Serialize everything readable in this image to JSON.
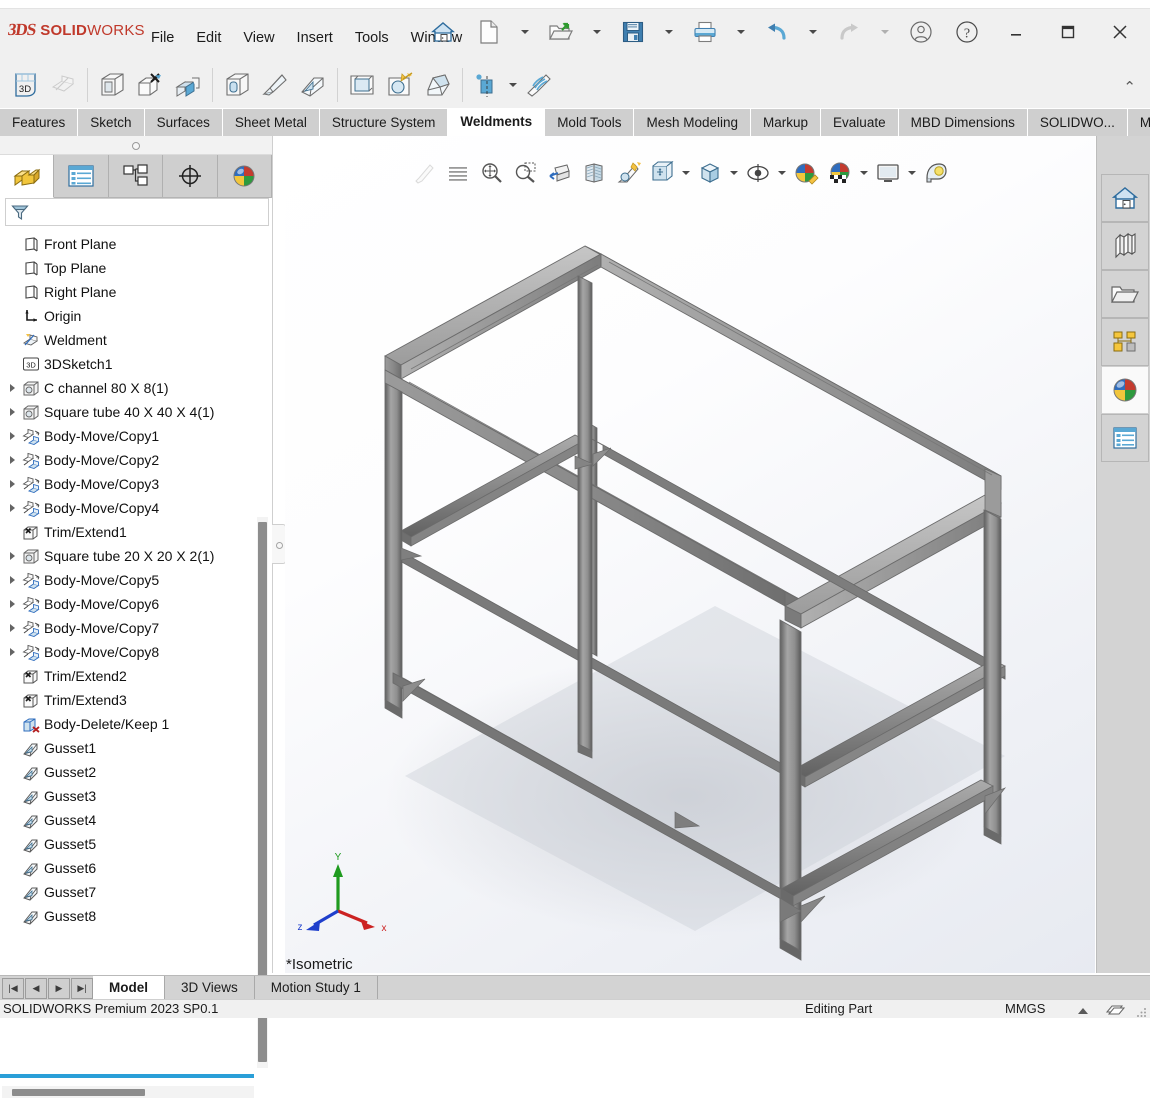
{
  "app": {
    "brand_ds": "3DS",
    "brand_bold": "SOLID",
    "brand_light": "WORKS",
    "accent": "#c0392b"
  },
  "menubar": {
    "items": [
      {
        "label": "File",
        "name": "menu-file"
      },
      {
        "label": "Edit",
        "name": "menu-edit"
      },
      {
        "label": "View",
        "name": "menu-view"
      },
      {
        "label": "Insert",
        "name": "menu-insert"
      },
      {
        "label": "Tools",
        "name": "menu-tools"
      },
      {
        "label": "Window",
        "name": "menu-window"
      }
    ],
    "pin_icon": "pin-icon"
  },
  "titlebar_buttons": [
    {
      "name": "home-button",
      "icon": "home-icon"
    },
    {
      "name": "new-document-button",
      "icon": "new-document-icon"
    },
    {
      "name": "open-button",
      "icon": "open-folder-icon"
    },
    {
      "name": "save-button",
      "icon": "save-floppy-icon"
    },
    {
      "name": "print-button",
      "icon": "printer-icon"
    },
    {
      "name": "undo-button",
      "icon": "undo-arrow-icon"
    },
    {
      "name": "redo-button",
      "icon": "redo-arrow-icon"
    },
    {
      "name": "account-button",
      "icon": "user-account-icon"
    },
    {
      "name": "help-button",
      "icon": "question-help-icon"
    },
    {
      "name": "minimize-button",
      "icon": "minimize-icon"
    },
    {
      "name": "maximize-button",
      "icon": "maximize-icon"
    },
    {
      "name": "close-button",
      "icon": "close-x-icon"
    }
  ],
  "commandbar": {
    "buttons": [
      {
        "name": "cmd-3d-sketch",
        "icon": "3d-sketch-icon",
        "label": "3D"
      },
      {
        "name": "cmd-structural-member",
        "icon": "structural-member-icon"
      },
      {
        "name": "cmd-trim-extend",
        "icon": "trim-extend-icon"
      },
      {
        "name": "cmd-extruded-boss",
        "icon": "extruded-boss-icon"
      },
      {
        "name": "cmd-fillet-bead",
        "icon": "fillet-bead-icon"
      },
      {
        "name": "cmd-end-cap",
        "icon": "end-cap-icon"
      },
      {
        "name": "cmd-gusset",
        "icon": "gusset-icon"
      },
      {
        "name": "cmd-weld-bead",
        "icon": "weld-bead-icon"
      },
      {
        "name": "cmd-extruded-cut",
        "icon": "extruded-cut-icon"
      },
      {
        "name": "cmd-hole-wizard",
        "icon": "hole-wizard-icon"
      },
      {
        "name": "cmd-chamfer",
        "icon": "chamfer-icon"
      },
      {
        "name": "cmd-mirror",
        "icon": "mirror-icon"
      },
      {
        "name": "cmd-weldment-cutlist",
        "icon": "weldment-cutlist-icon"
      }
    ],
    "collapse_icon": "chevron-up-icon"
  },
  "ribbon_tabs": [
    {
      "label": "Features",
      "active": false
    },
    {
      "label": "Sketch",
      "active": false
    },
    {
      "label": "Surfaces",
      "active": false
    },
    {
      "label": "Sheet Metal",
      "active": false
    },
    {
      "label": "Structure System",
      "active": false
    },
    {
      "label": "Weldments",
      "active": true
    },
    {
      "label": "Mold Tools",
      "active": false
    },
    {
      "label": "Mesh Modeling",
      "active": false
    },
    {
      "label": "Markup",
      "active": false
    },
    {
      "label": "Evaluate",
      "active": false
    },
    {
      "label": "MBD Dimensions",
      "active": false
    },
    {
      "label": "SOLIDWO...",
      "active": false
    },
    {
      "label": "M...",
      "active": false
    }
  ],
  "left_panel": {
    "tabs": [
      {
        "name": "tab-feature-manager-design-tree",
        "icon": "feature-tree-icon",
        "active": true
      },
      {
        "name": "tab-property-manager",
        "icon": "property-manager-icon",
        "active": false
      },
      {
        "name": "tab-configuration-manager",
        "icon": "configuration-manager-icon",
        "active": false
      },
      {
        "name": "tab-dimxpert-manager",
        "icon": "dimxpert-target-icon",
        "active": false
      },
      {
        "name": "tab-display-manager",
        "icon": "display-manager-sphere-icon",
        "active": false
      }
    ],
    "filter_icon": "filter-funnel-icon",
    "filter_placeholder": "",
    "filter_value": "",
    "tree": [
      {
        "label": "Front Plane",
        "icon": "plane-icon",
        "expandable": false
      },
      {
        "label": "Top Plane",
        "icon": "plane-icon",
        "expandable": false
      },
      {
        "label": "Right Plane",
        "icon": "plane-icon",
        "expandable": false
      },
      {
        "label": "Origin",
        "icon": "origin-icon",
        "expandable": false
      },
      {
        "label": "Weldment",
        "icon": "weldment-icon",
        "expandable": false
      },
      {
        "label": "3DSketch1",
        "icon": "3d-sketch-icon",
        "expandable": false
      },
      {
        "label": "C channel 80 X 8(1)",
        "icon": "structural-member-icon",
        "expandable": true
      },
      {
        "label": "Square tube 40 X 40 X 4(1)",
        "icon": "structural-member-icon",
        "expandable": true
      },
      {
        "label": "Body-Move/Copy1",
        "icon": "body-move-copy-icon",
        "expandable": true
      },
      {
        "label": "Body-Move/Copy2",
        "icon": "body-move-copy-icon",
        "expandable": true
      },
      {
        "label": "Body-Move/Copy3",
        "icon": "body-move-copy-icon",
        "expandable": true
      },
      {
        "label": "Body-Move/Copy4",
        "icon": "body-move-copy-icon",
        "expandable": true
      },
      {
        "label": "Trim/Extend1",
        "icon": "trim-extend-icon",
        "expandable": false
      },
      {
        "label": "Square tube 20 X 20 X 2(1)",
        "icon": "structural-member-icon",
        "expandable": true
      },
      {
        "label": "Body-Move/Copy5",
        "icon": "body-move-copy-icon",
        "expandable": true
      },
      {
        "label": "Body-Move/Copy6",
        "icon": "body-move-copy-icon",
        "expandable": true
      },
      {
        "label": "Body-Move/Copy7",
        "icon": "body-move-copy-icon",
        "expandable": true
      },
      {
        "label": "Body-Move/Copy8",
        "icon": "body-move-copy-icon",
        "expandable": true
      },
      {
        "label": "Trim/Extend2",
        "icon": "trim-extend-icon",
        "expandable": false
      },
      {
        "label": "Trim/Extend3",
        "icon": "trim-extend-icon",
        "expandable": false
      },
      {
        "label": "Body-Delete/Keep 1",
        "icon": "body-delete-keep-icon",
        "expandable": false
      },
      {
        "label": "Gusset1",
        "icon": "gusset-icon",
        "expandable": false
      },
      {
        "label": "Gusset2",
        "icon": "gusset-icon",
        "expandable": false
      },
      {
        "label": "Gusset3",
        "icon": "gusset-icon",
        "expandable": false
      },
      {
        "label": "Gusset4",
        "icon": "gusset-icon",
        "expandable": false
      },
      {
        "label": "Gusset5",
        "icon": "gusset-icon",
        "expandable": false
      },
      {
        "label": "Gusset6",
        "icon": "gusset-icon",
        "expandable": false
      },
      {
        "label": "Gusset7",
        "icon": "gusset-icon",
        "expandable": false
      },
      {
        "label": "Gusset8",
        "icon": "gusset-icon",
        "expandable": false
      }
    ]
  },
  "viewport": {
    "view_label": "*Isometric",
    "triad": {
      "x_label": "x",
      "y_label": "Y",
      "z_label": "z",
      "x_color": "#cc2222",
      "y_color": "#1f9b1f",
      "z_color": "#1f3fcc"
    },
    "hud_buttons": [
      {
        "name": "hud-edit-appearance",
        "icon": "paintbrush-icon",
        "disabled": true
      },
      {
        "name": "hud-display-style-list",
        "icon": "lines-icon"
      },
      {
        "name": "hud-zoom-to-fit",
        "icon": "zoom-to-fit-icon"
      },
      {
        "name": "hud-zoom-to-area",
        "icon": "zoom-to-area-icon"
      },
      {
        "name": "hud-previous-view",
        "icon": "previous-view-icon"
      },
      {
        "name": "hud-section-view",
        "icon": "section-view-icon"
      },
      {
        "name": "hud-view-orientation-flyout",
        "icon": "view-orientation-icon"
      },
      {
        "name": "hud-display-style",
        "icon": "display-style-cube-icon",
        "caret": true
      },
      {
        "name": "hud-hide-show-items",
        "icon": "hide-show-eye-icon",
        "caret": true
      },
      {
        "name": "hud-edit-appearance-sphere",
        "icon": "appearance-sphere-pencil-icon"
      },
      {
        "name": "hud-apply-scene",
        "icon": "apply-scene-icon",
        "caret": true
      },
      {
        "name": "hud-view-settings",
        "icon": "view-settings-monitor-icon",
        "caret": true
      },
      {
        "name": "hud-measure",
        "icon": "measure-tape-icon"
      }
    ]
  },
  "task_pane": [
    {
      "name": "taskpane-solidworks-resources",
      "icon": "home-icon",
      "lit": false
    },
    {
      "name": "taskpane-design-library",
      "icon": "design-library-books-icon",
      "lit": false
    },
    {
      "name": "taskpane-file-explorer",
      "icon": "file-explorer-folder-icon",
      "lit": false
    },
    {
      "name": "taskpane-view-palette",
      "icon": "view-palette-icon",
      "lit": false
    },
    {
      "name": "taskpane-appearances-scenes",
      "icon": "appearances-sphere-icon",
      "lit": true
    },
    {
      "name": "taskpane-custom-properties",
      "icon": "custom-properties-icon",
      "lit": false
    }
  ],
  "bottom": {
    "nav_buttons": [
      "first-tab-icon",
      "previous-tab-icon",
      "next-tab-icon",
      "last-tab-icon"
    ],
    "tabs": [
      {
        "label": "Model",
        "active": true
      },
      {
        "label": "3D Views",
        "active": false
      },
      {
        "label": "Motion Study 1",
        "active": false
      }
    ]
  },
  "statusbar": {
    "version": "SOLIDWORKS Premium 2023 SP0.1",
    "edit_state": "Editing Part",
    "units": "MMGS",
    "units_caret": "caret-up-icon",
    "overlay_icon": "sheet-overlay-icon",
    "resize_grip": "resize-grip-icon"
  }
}
